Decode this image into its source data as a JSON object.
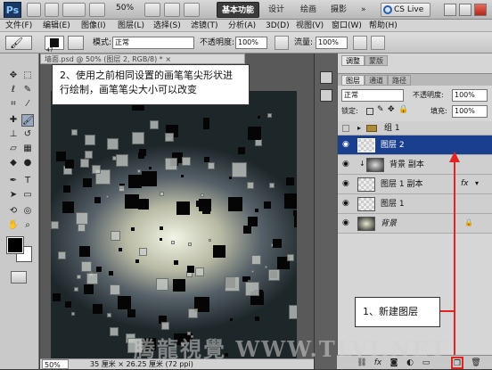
{
  "appbar": {
    "zoom": "50%",
    "workspaces": [
      "基本功能",
      "设计",
      "绘画",
      "摄影"
    ],
    "more": "»",
    "cs_live": "CS Live"
  },
  "menu": [
    "文件(F)",
    "编辑(E)",
    "图像(I)",
    "图层(L)",
    "选择(S)",
    "滤镜(T)",
    "分析(A)",
    "3D(D)",
    "视图(V)",
    "窗口(W)",
    "帮助(H)"
  ],
  "options": {
    "brush_size": "47",
    "mode_label": "模式:",
    "mode_value": "正常",
    "opacity_label": "不透明度:",
    "opacity_value": "100%",
    "flow_label": "流量:",
    "flow_value": "100%"
  },
  "document": {
    "tab_title": "墙面.psd @ 50% (图层 2, RGB/8) * ×",
    "status_zoom": "50%",
    "status_info": "35 厘米 × 26.25 厘米 (72 ppi)"
  },
  "callouts": {
    "step2": "2、使用之前相同设置的画笔笔尖形状进行绘制，画笔笔尖大小可以改变",
    "step1": "1、新建图层"
  },
  "panel": {
    "top_tabs": [
      "调整",
      "蒙版"
    ],
    "tabs": [
      "图层",
      "通道",
      "路径"
    ],
    "blend_mode": "正常",
    "opacity_label": "不透明度:",
    "opacity_value": "100%",
    "lock_label": "锁定:",
    "fill_label": "填充:",
    "fill_value": "100%",
    "layers": [
      {
        "name": "组 1"
      },
      {
        "name": "图层 2"
      },
      {
        "name": "背景 副本"
      },
      {
        "name": "图层 1 副本"
      },
      {
        "name": "图层 1"
      },
      {
        "name": "背景"
      }
    ],
    "fx": "fx"
  },
  "watermark": "腾龍視覺 WWW.TLVI.NET",
  "colors": {
    "selected_layer": "#1b3f8f",
    "annotation_red": "#e02424",
    "active_workspace": "#3b3b3b"
  }
}
